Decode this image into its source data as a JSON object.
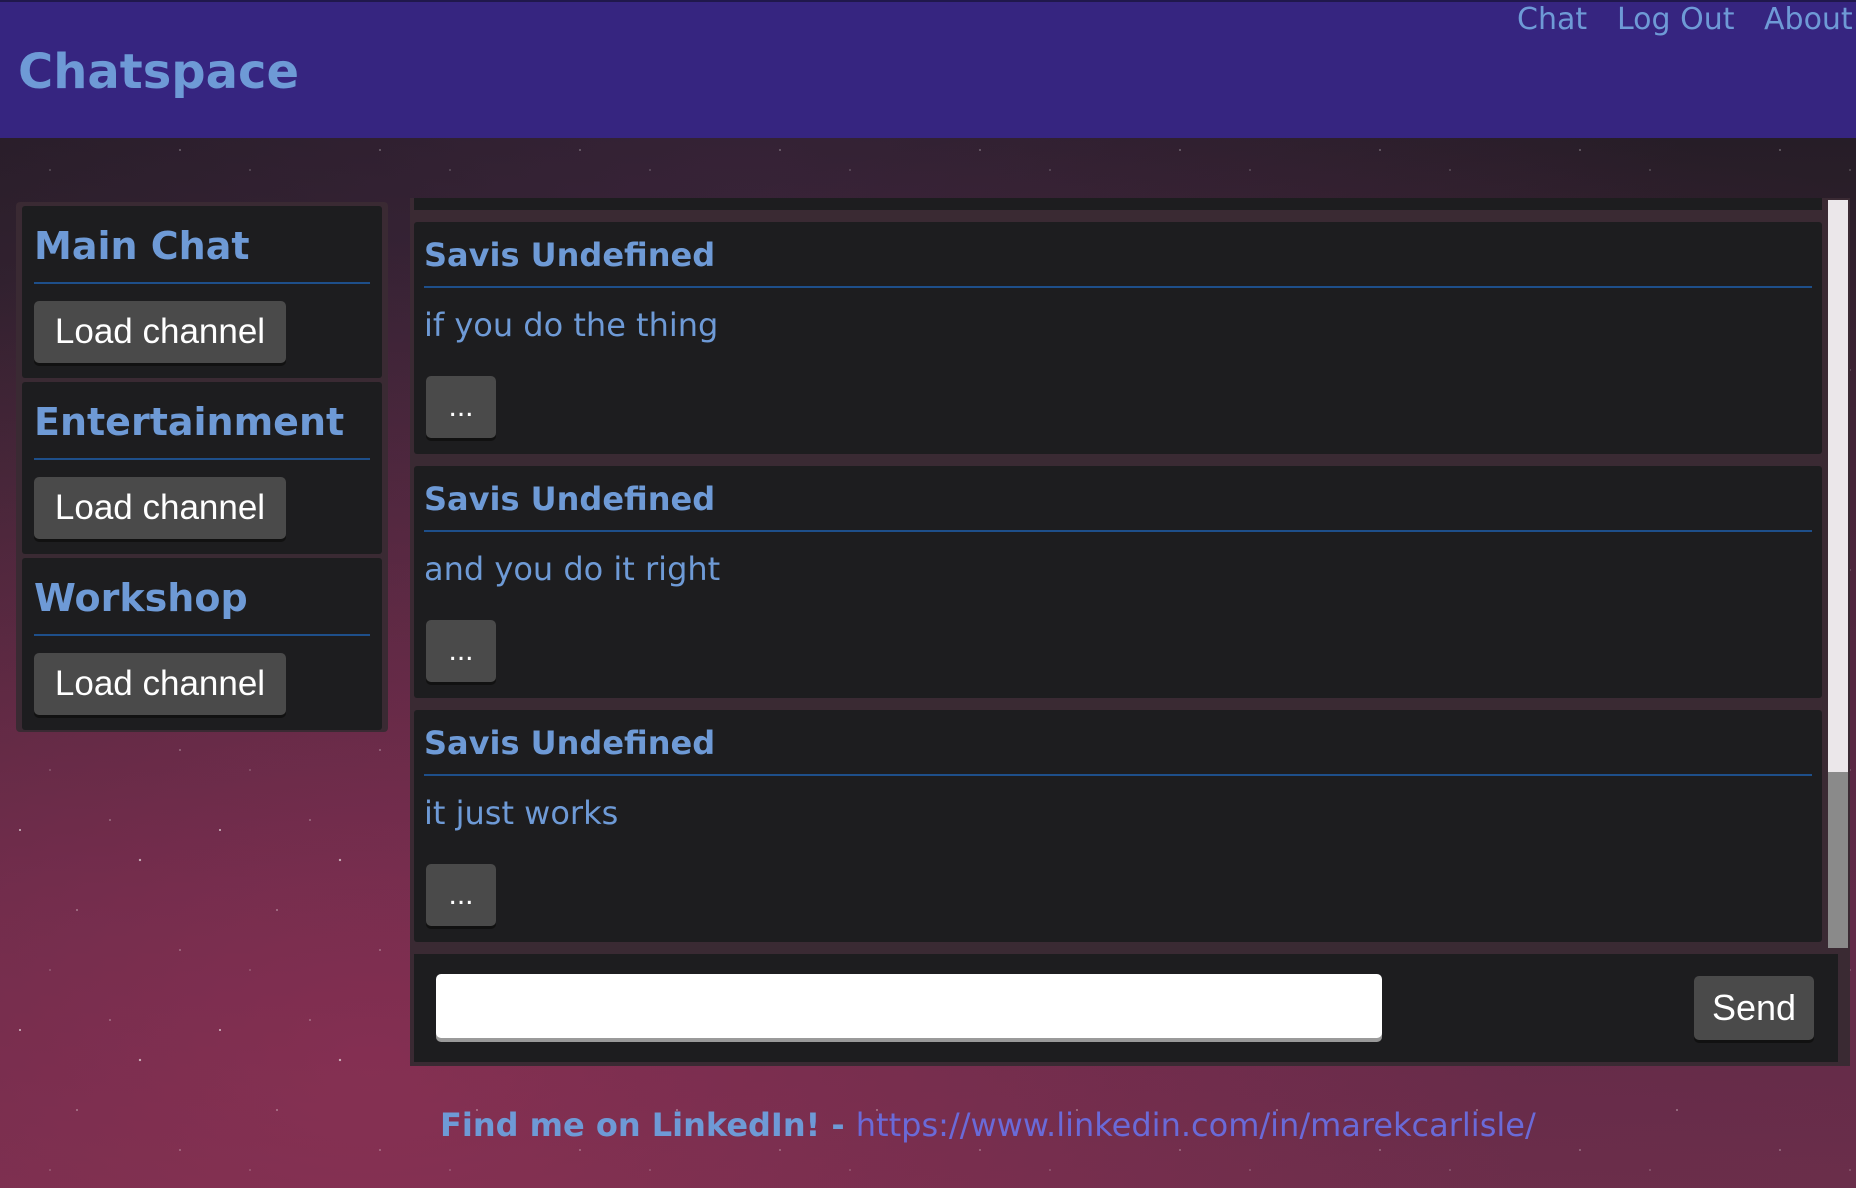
{
  "app": {
    "brand": "Chatspace"
  },
  "nav": {
    "items": [
      {
        "label": "Chat"
      },
      {
        "label": "Log Out"
      },
      {
        "label": "About"
      }
    ]
  },
  "channels": [
    {
      "name": "Main Chat",
      "button_label": "Load channel"
    },
    {
      "name": "Entertainment",
      "button_label": "Load channel"
    },
    {
      "name": "Workshop",
      "button_label": "Load channel"
    }
  ],
  "messages": [
    {
      "author": "Savis Undefined",
      "text": "if you do the thing",
      "more_label": "..."
    },
    {
      "author": "Savis Undefined",
      "text": "and you do it right",
      "more_label": "..."
    },
    {
      "author": "Savis Undefined",
      "text": "it just works",
      "more_label": "..."
    }
  ],
  "composer": {
    "input_value": "",
    "send_label": "Send"
  },
  "footer": {
    "label": "Find me on LinkedIn! - ",
    "link": "https://www.linkedin.com/in/marekcarlisle/"
  },
  "colors": {
    "navbar": "#362580",
    "accent_text": "#6e9ad6",
    "panel": "#1d1d1f",
    "button": "#4a4a4a",
    "link": "#6a6ad8"
  }
}
